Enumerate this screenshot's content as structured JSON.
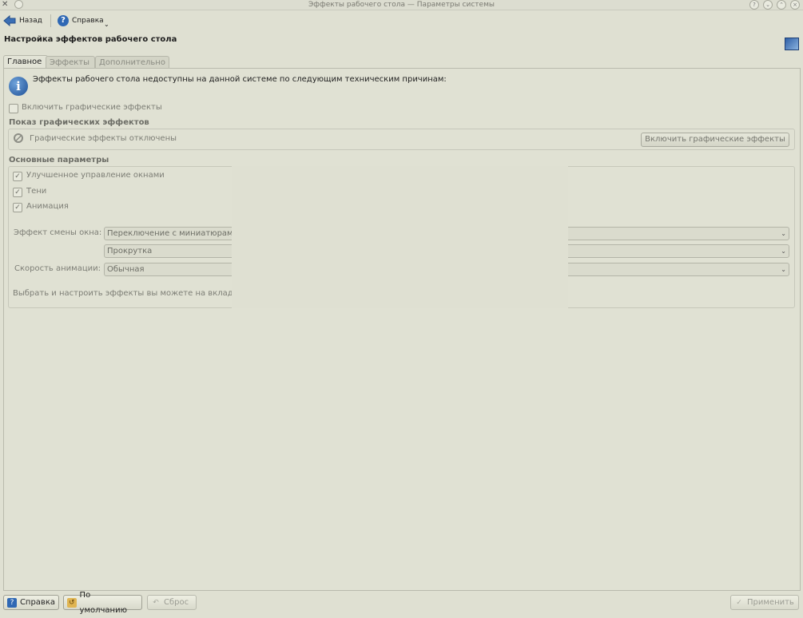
{
  "window": {
    "title": "Эффекты рабочего стола — Параметры системы"
  },
  "toolbar": {
    "back_label": "Назад",
    "help_label": "Справка"
  },
  "page": {
    "heading": "Настройка эффектов рабочего стола"
  },
  "tabs": [
    {
      "label": "Главное",
      "active": true
    },
    {
      "label": "Эффекты",
      "active": false
    },
    {
      "label": "Дополнительно",
      "active": false
    }
  ],
  "info": {
    "message": "Эффекты рабочего стола недоступны на данной системе по следующим техническим причинам:"
  },
  "enable_checkbox": {
    "label": "Включить графические эффекты",
    "checked": false
  },
  "show_effects": {
    "header": "Показ графических эффектов",
    "status": "Графические эффекты отключены",
    "button": "Включить графические эффекты"
  },
  "main_params": {
    "header": "Основные параметры",
    "checkboxes": [
      {
        "label": "Улучшенное управление окнами",
        "checked": true
      },
      {
        "label": "Тени",
        "checked": true
      },
      {
        "label": "Анимация",
        "checked": true
      }
    ],
    "window_switch_label": "Эффект смены окна:",
    "window_switch_value": "Переключение с миниатюрами",
    "desktop_switch_value": "Прокрутка",
    "anim_speed_label": "Скорость анимации:",
    "anim_speed_value": "Обычная",
    "hint": "Выбрать и настроить эффекты вы можете на вклад"
  },
  "bottom": {
    "help": "Справка",
    "defaults": "По умолчанию",
    "reset": "Сброс",
    "apply": "Применить"
  },
  "icons": {
    "titlebar_app": "tools-icon",
    "back": "arrow-left-icon",
    "help": "help-icon",
    "info": "info-icon",
    "disabled": "disabled-icon",
    "header_config": "desktop-config-icon"
  }
}
